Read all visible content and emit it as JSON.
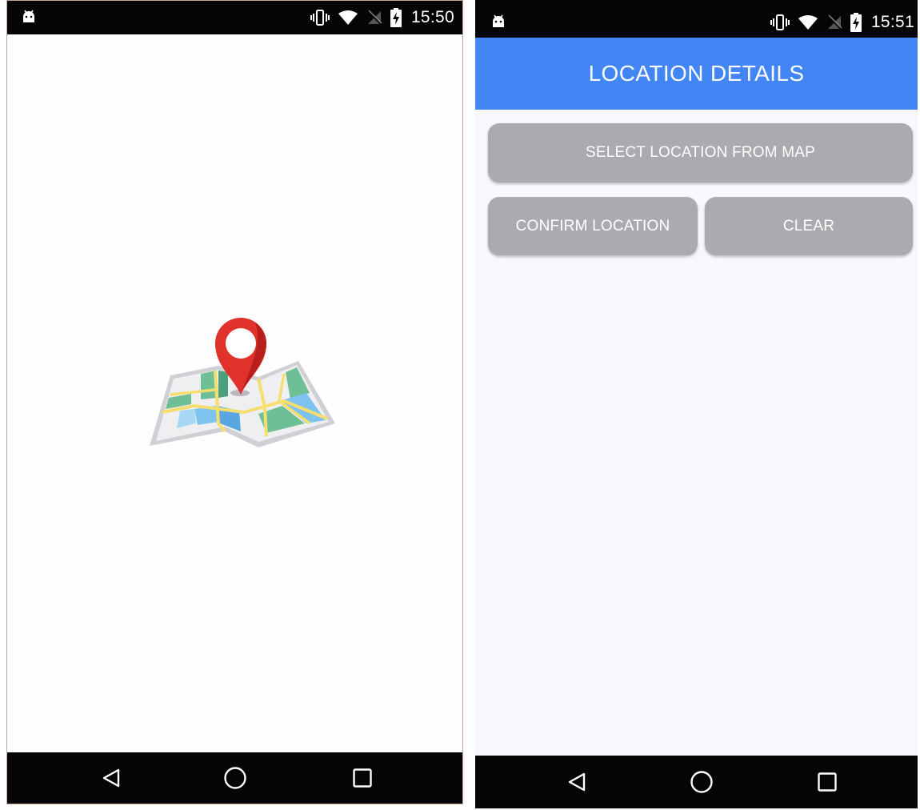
{
  "left_screen": {
    "status_bar": {
      "time": "15:50",
      "icons": [
        "android-debug-icon",
        "vibrate-icon",
        "wifi-icon",
        "no-sim-icon",
        "battery-charging-icon"
      ]
    },
    "splash_icon": "map-pin-icon",
    "nav_bar": {
      "buttons": [
        "back-icon",
        "home-icon",
        "recents-icon"
      ]
    }
  },
  "right_screen": {
    "status_bar": {
      "time": "15:51",
      "icons": [
        "android-debug-icon",
        "vibrate-icon",
        "wifi-icon",
        "no-sim-icon",
        "battery-charging-icon"
      ]
    },
    "app_bar": {
      "title": "LOCATION DETAILS"
    },
    "buttons": {
      "select_location": "SELECT LOCATION FROM MAP",
      "confirm_location": "CONFIRM LOCATION",
      "clear": "CLEAR"
    },
    "nav_bar": {
      "buttons": [
        "back-icon",
        "home-icon",
        "recents-icon"
      ]
    }
  },
  "colors": {
    "app_bar": "#4285f4",
    "button": "#acaaaf",
    "status_bar": "#050505",
    "pin": "#e0312b"
  }
}
